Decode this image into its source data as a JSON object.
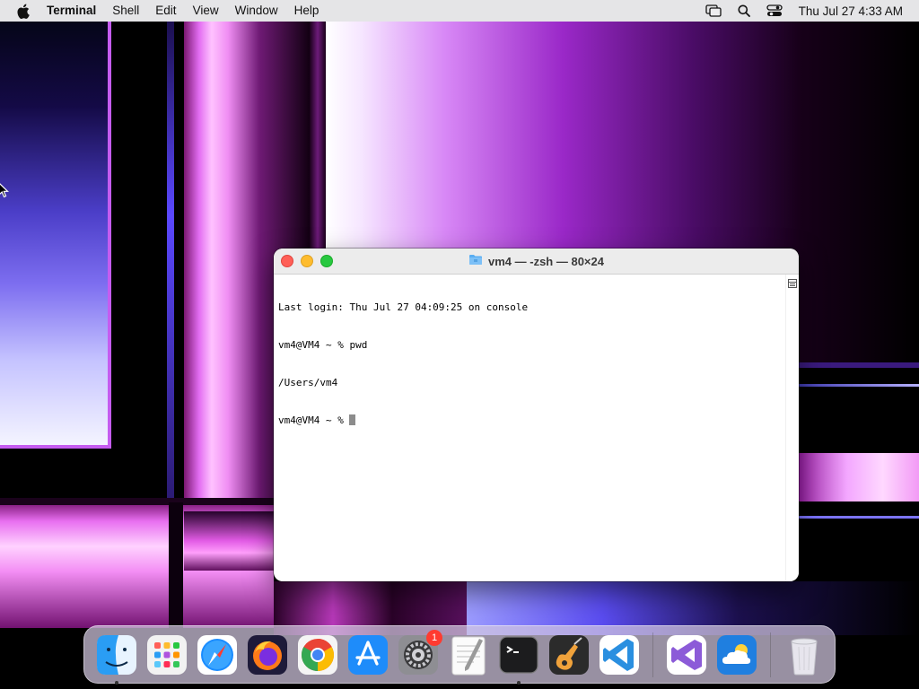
{
  "menubar": {
    "app_name": "Terminal",
    "items": [
      "Shell",
      "Edit",
      "View",
      "Window",
      "Help"
    ],
    "clock": "Thu Jul 27  4:33 AM"
  },
  "terminal": {
    "title": "vm4 — -zsh — 80×24",
    "lines": [
      "Last login: Thu Jul 27 04:09:25 on console",
      "vm4@VM4 ~ % pwd",
      "/Users/vm4",
      "vm4@VM4 ~ % "
    ]
  },
  "dock": {
    "items": [
      {
        "name": "Finder",
        "icon": "finder-icon",
        "running": true
      },
      {
        "name": "Launchpad",
        "icon": "launchpad-icon",
        "running": false
      },
      {
        "name": "Safari",
        "icon": "safari-icon",
        "running": false
      },
      {
        "name": "Firefox",
        "icon": "firefox-icon",
        "running": false
      },
      {
        "name": "Google Chrome",
        "icon": "chrome-icon",
        "running": false
      },
      {
        "name": "App Store",
        "icon": "app-store-icon",
        "running": false
      },
      {
        "name": "System Settings",
        "icon": "system-settings-icon",
        "running": false,
        "badge": "1"
      },
      {
        "name": "TextEdit",
        "icon": "textedit-icon",
        "running": false
      },
      {
        "name": "Terminal",
        "icon": "terminal-icon",
        "running": true
      },
      {
        "name": "GarageBand",
        "icon": "garageband-icon",
        "running": false
      },
      {
        "name": "Visual Studio Code",
        "icon": "vscode-icon",
        "running": false
      },
      {
        "name": "Visual Studio",
        "icon": "visual-studio-icon",
        "running": false
      },
      {
        "name": "Weather",
        "icon": "weather-icon",
        "running": false
      },
      {
        "name": "Trash",
        "icon": "trash-icon",
        "running": false
      }
    ]
  }
}
